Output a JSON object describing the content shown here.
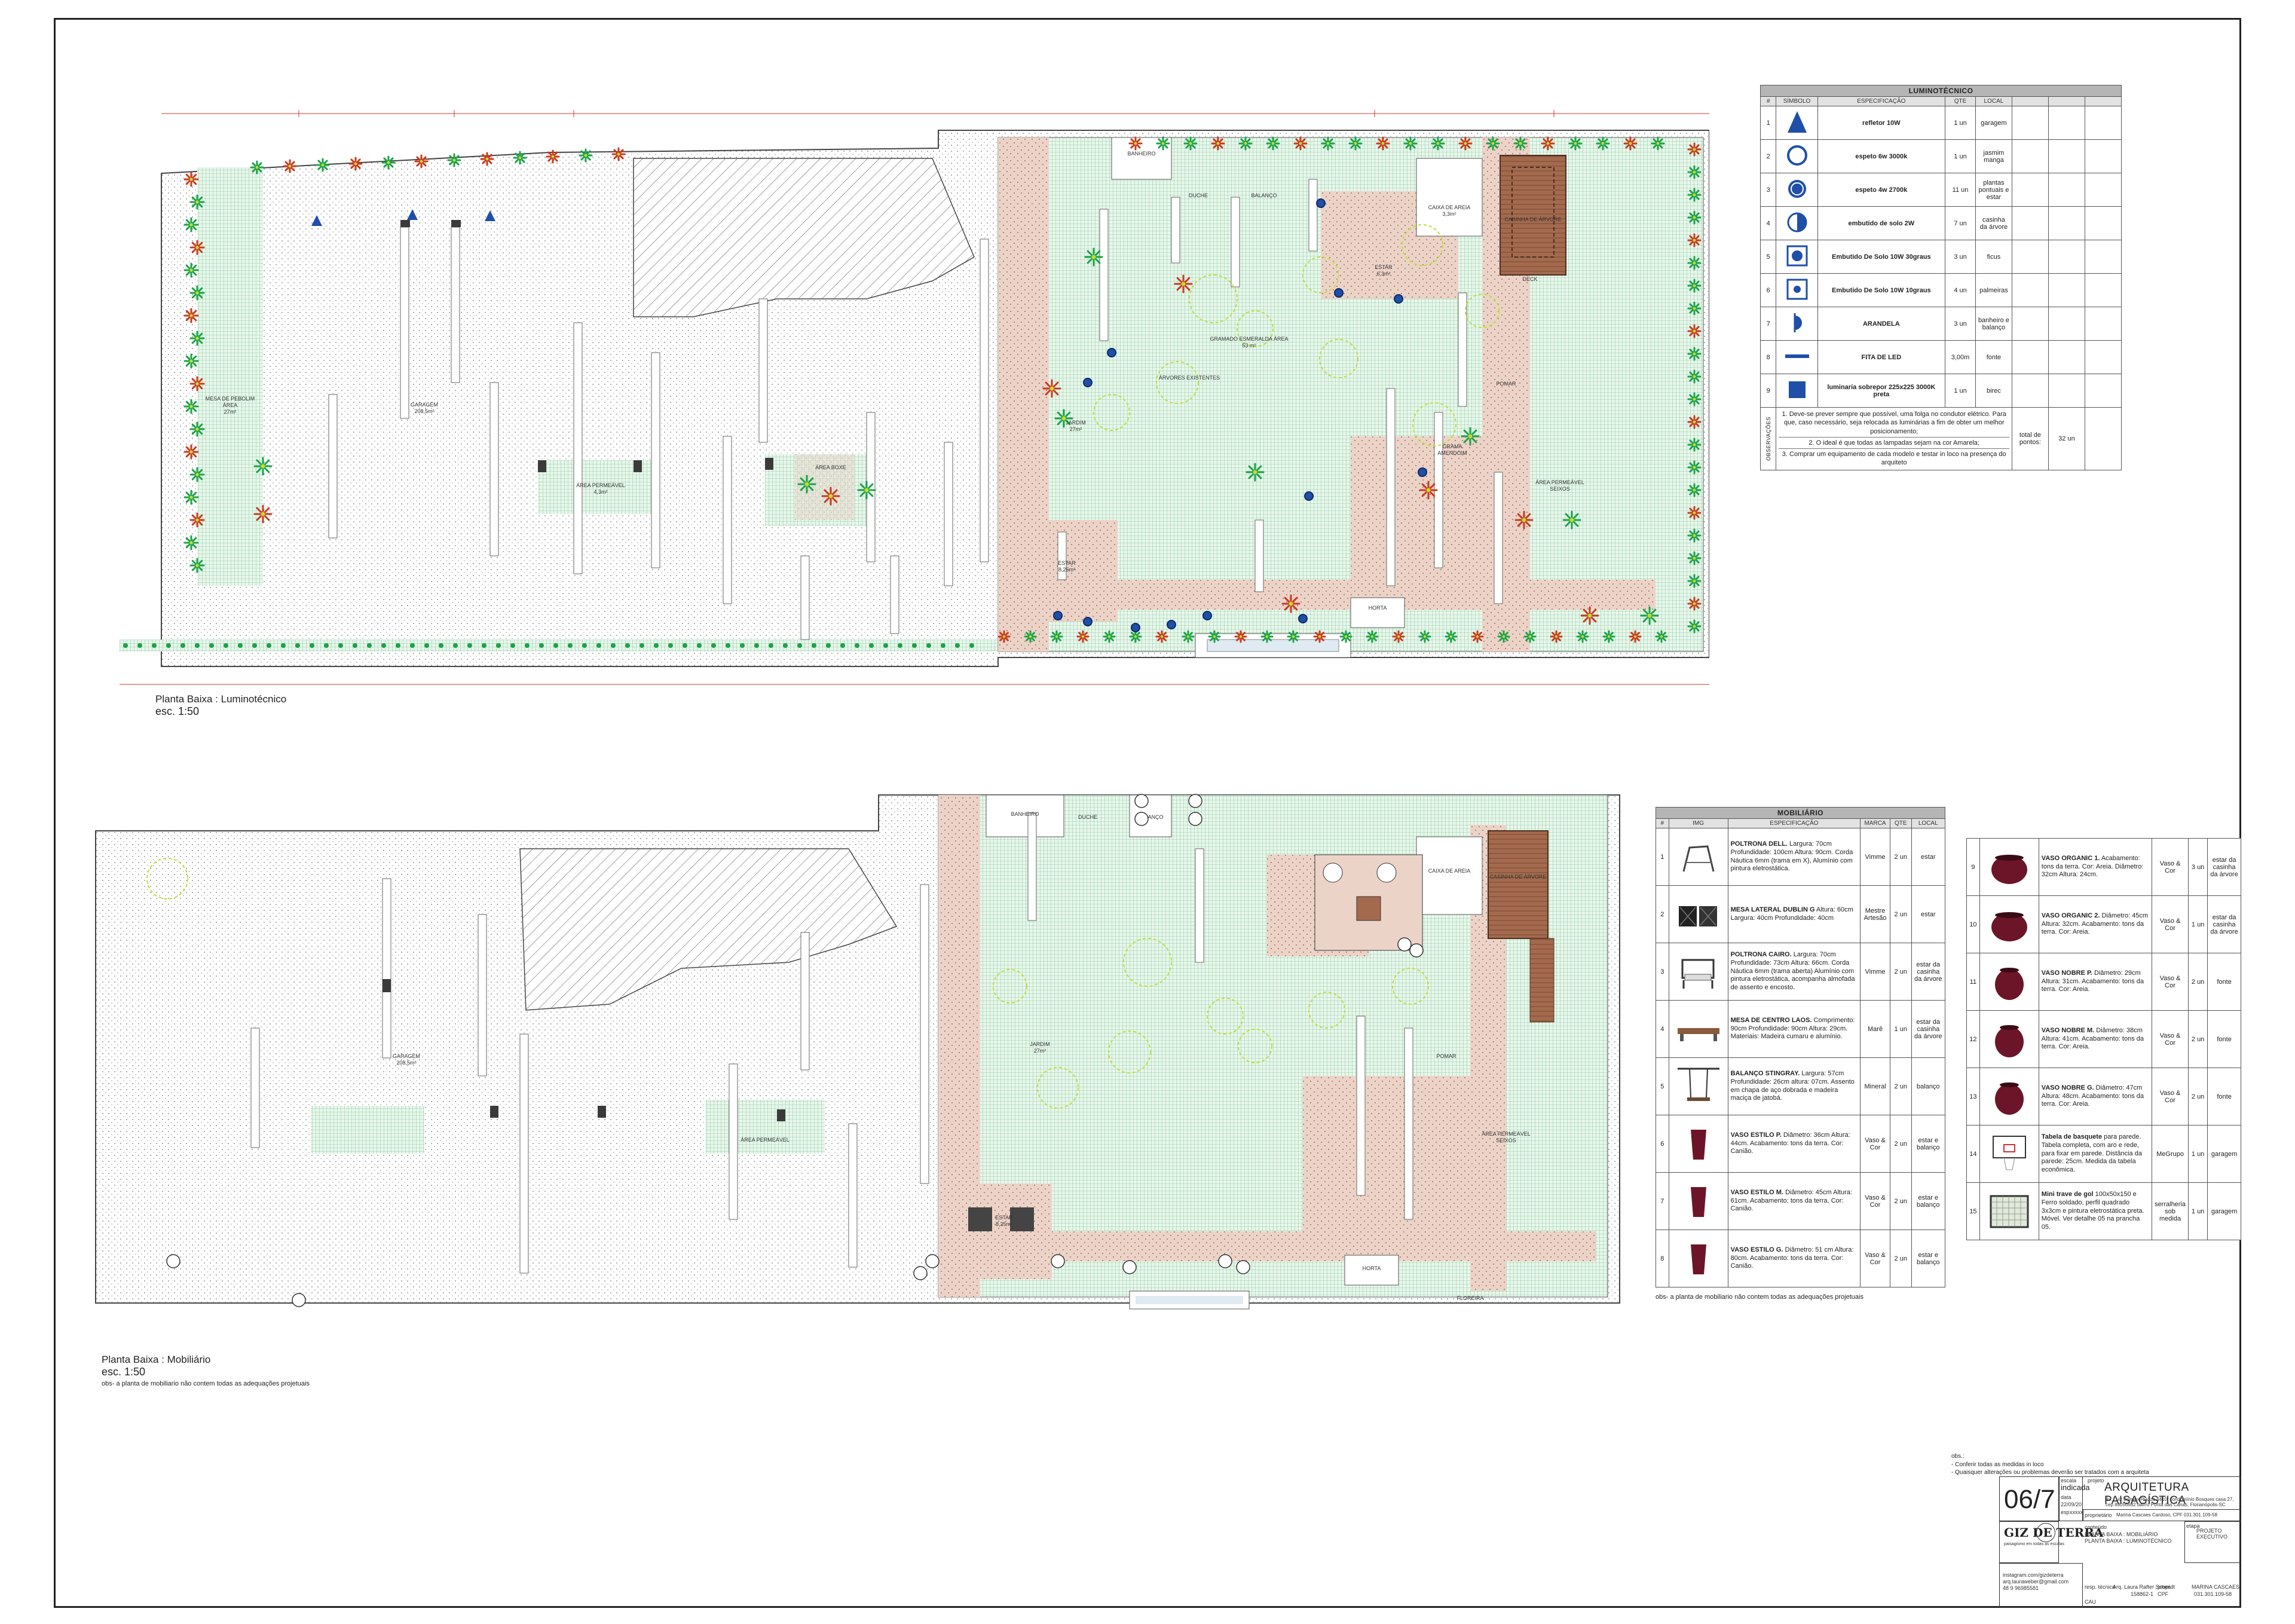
{
  "plan_top": {
    "caption_title": "Planta Baixa : Luminotécnico",
    "caption_scale": "esc. 1:50",
    "labels": {
      "garagem": "GARAGEM\n208,5m²",
      "mesa_futebol": "MESA DE PEBOLIM\nÁREA\n27m²",
      "area_permeavel": "ÁREA PERMEÁVEL\n4,3m²",
      "area_boxe": "ÁREA BOXE",
      "gramado": "GRAMADO ESMERALDA ÁREA\n53 m²",
      "arvores": "ÁRVORES EXISTENTES",
      "jardim": "JARDIM\n27m²",
      "estar": "ESTAR\n8,25m²",
      "estar_arvore": "ESTAR\n6,3m²",
      "caixa_areia": "CAIXA DE AREIA\n3,3m²",
      "casinha": "CASINHA DE ÁRVORE",
      "banheiro": "BANHEIRO",
      "horta": "HORTA",
      "pomar": "POMAR",
      "grama": "GRAMA\nAMENDOIM",
      "area_permeavel2": "ÁREA PERMEÁVEL\nSEIXOS",
      "duche": "DUCHE",
      "balanco": "BALANÇO",
      "deck": "DECK"
    }
  },
  "plan_bottom": {
    "caption_title": "Planta Baixa : Mobiliário",
    "caption_scale": "esc. 1:50",
    "caption_note": "obs- a planta de mobiliario não contem todas as adequações projetuais",
    "labels": {
      "garagem": "GARAGEM\n208,5m²",
      "banheiro": "BANHEIRO",
      "balanco": "BALANÇO",
      "duche": "DUCHE",
      "jardim": "JARDIM\n27m²",
      "estar": "ESTAR\n8,25m²",
      "caixa_areia": "CAIXA DE AREIA",
      "casinha": "CASINHA DE ÁRVORE",
      "pomar": "POMAR",
      "area_permeavel": "ÁREA PERMEÁVEL\nSEIXOS",
      "area_permeavel2": "ÁREA PERMEÁVEL",
      "horta": "HORTA",
      "floreira": "FLOREIRA"
    }
  },
  "luminotecnico": {
    "title": "LUMINOTÉCNICO",
    "headers": [
      "#",
      "SÍMBOLO",
      "ESPECIFICAÇÃO",
      "QTE",
      "LOCAL"
    ],
    "rows": [
      {
        "n": "1",
        "spec": "refletor 10W",
        "qte": "1 un",
        "local": "garagem",
        "icon": "triangle-icon"
      },
      {
        "n": "2",
        "spec": "espeto 6w 3000k",
        "qte": "1 un",
        "local": "jasmim manga",
        "icon": "ring-icon"
      },
      {
        "n": "3",
        "spec": "espeto 4w 2700k",
        "qte": "11 un",
        "local": "plantas pontuais e estar",
        "icon": "dot-ring-icon"
      },
      {
        "n": "4",
        "spec": "embutido de solo 2W",
        "qte": "7 un",
        "local": "casinha da árvore",
        "icon": "half-circle-icon"
      },
      {
        "n": "5",
        "spec": "Embutido De Solo 10W 30graus",
        "qte": "3 un",
        "local": "ficus",
        "icon": "square-circle-icon"
      },
      {
        "n": "6",
        "spec": "Embutido De Solo 10W 10graus",
        "qte": "4 un",
        "local": "palmeiras",
        "icon": "square-dot-icon"
      },
      {
        "n": "7",
        "spec": "ARANDELA",
        "qte": "3 un",
        "local": "banheiro e balanço",
        "icon": "arandela-icon"
      },
      {
        "n": "8",
        "spec": "FITA DE LED",
        "qte": "3,00m",
        "local": "fonte",
        "icon": "led-strip-icon"
      },
      {
        "n": "9",
        "spec": "luminaria sobrepor 225x225 3000K preta",
        "qte": "1 un",
        "local": "birec",
        "icon": "filled-square-icon"
      }
    ],
    "obs_label": "OBSERVAÇÕES",
    "obs": [
      "1. Deve-se prever sempre que possível, uma folga no condutor elétrico. Para que, caso necessário, seja relocada as luminárias a fim de obter um melhor posicionamento;",
      "2. O ideal é que todas as lampadas sejam na cor Amarela;",
      "3. Comprar um equipamento de cada modelo e testar in loco na presença do arquiteto"
    ],
    "total_label": "total de pontos:",
    "total_value": "32 un"
  },
  "mobiliario": {
    "title": "MOBILIÁRIO",
    "headers": [
      "#",
      "IMG",
      "ESPECIFICAÇÃO",
      "MARCA",
      "QTE",
      "LOCAL"
    ],
    "left_rows": [
      {
        "n": "1",
        "name": "POLTRONA DELL.",
        "desc": "Largura: 70cm Profundidade: 100cm Altura: 90cm. Corda Náutica 6mm (trama em X), Alumínio com pintura eletrostática.",
        "marca": "Vimme",
        "qte": "2 un",
        "local": "estar",
        "img": "chair-icon"
      },
      {
        "n": "2",
        "name": "MESA LATERAL DUBLIN G",
        "desc": "Altura: 60cm Largura: 40cm Profundidade: 40cm",
        "marca": "Mestre Artesão",
        "qte": "2 un",
        "local": "estar",
        "img": "side-table-icon"
      },
      {
        "n": "3",
        "name": "POLTRONA CAIRO.",
        "desc": "Largura: 70cm Profundidade: 73cm Altura: 66cm. Corda Náutica 6mm (trama aberta) Alumínio com pintura eletrostática, acompanha almofada de assento e encosto.",
        "marca": "Vimme",
        "qte": "2 un",
        "local": "estar da casinha da árvore",
        "img": "armchair-icon"
      },
      {
        "n": "4",
        "name": "MESA DE CENTRO LAOS.",
        "desc": "Comprimento: 90cm Profundidade: 90cm Altura: 29cm. Materiais: Madeira cumaru e alumínio.",
        "marca": "Marê",
        "qte": "1 un",
        "local": "estar da casinha da árvore",
        "img": "coffee-table-icon"
      },
      {
        "n": "5",
        "name": "BALANÇO STINGRAY.",
        "desc": "Largura: 57cm Profundidade: 26cm altura: 07cm. Assento em chapa de aço dobrada e madeira maciça de jatobá.",
        "marca": "Mineral",
        "qte": "2 un",
        "local": "balanço",
        "img": "swing-icon"
      },
      {
        "n": "6",
        "name": "VASO ESTILO P.",
        "desc": "Diâmetro: 36cm Altura: 44cm. Acabamento: tons da terra. Cor: Canião.",
        "marca": "Vaso & Cor",
        "qte": "2 un",
        "local": "estar e balanço",
        "img": "vase-icon"
      },
      {
        "n": "7",
        "name": "VASO ESTILO M.",
        "desc": "Diâmetro: 45cm Altura: 61cm. Acabamento: tons da terra. Cor: Canião.",
        "marca": "Vaso & Cor",
        "qte": "2 un",
        "local": "estar e balanço",
        "img": "vase-icon"
      },
      {
        "n": "8",
        "name": "VASO ESTILO G.",
        "desc": "Diâmetro: 51 cm Altura: 80cm. Acabamento: tons da terra. Cor: Canião.",
        "marca": "Vaso & Cor",
        "qte": "2 un",
        "local": "estar e balanço",
        "img": "vase-icon"
      }
    ],
    "right_rows": [
      {
        "n": "9",
        "name": "VASO ORGANIC 1.",
        "desc": "Acabamento: tons da terra. Cor: Areia. Diâmetro: 32cm Altura: 24cm.",
        "marca": "Vaso & Cor",
        "qte": "3 un",
        "local": "estar da casinha da árvore",
        "img": "bowl-vase-icon"
      },
      {
        "n": "10",
        "name": "VASO ORGANIC 2.",
        "desc": "Diâmetro: 45cm Altura: 32cm. Acabamento: tons da terra. Cor: Areia.",
        "marca": "Vaso & Cor",
        "qte": "1 un",
        "local": "estar da casinha da árvore",
        "img": "bowl-vase-icon"
      },
      {
        "n": "11",
        "name": "VASO NOBRE P.",
        "desc": "Diâmetro: 29cm Altura: 31cm. Acabamento: tons da terra. Cor: Areia.",
        "marca": "Vaso & Cor",
        "qte": "2 un",
        "local": "fonte",
        "img": "round-vase-icon"
      },
      {
        "n": "12",
        "name": "VASO NOBRE M.",
        "desc": "Diâmetro: 38cm Altura: 41cm. Acabamento: tons da terra. Cor: Areia.",
        "marca": "Vaso & Cor",
        "qte": "2 un",
        "local": "fonte",
        "img": "round-vase-icon"
      },
      {
        "n": "13",
        "name": "VASO NOBRE G.",
        "desc": "Diâmetro: 47cm Altura: 48cm. Acabamento: tons da terra. Cor: Areia.",
        "marca": "Vaso & Cor",
        "qte": "2 un",
        "local": "fonte",
        "img": "round-vase-icon"
      },
      {
        "n": "14",
        "name": "Tabela de basquete",
        "desc": "para parede. Tabela completa, com aro e rede, para fixar em parede. Distância da parede: 25cm. Medida da tabela econômica.",
        "marca": "MeGrupo",
        "qte": "1 un",
        "local": "garagem",
        "img": "basketball-icon"
      },
      {
        "n": "15",
        "name": "Mini trave de gol",
        "desc": "100x50x150 e Ferro soldado, perfil quadrado 3x3cm e pintura eletrostática preta. Móvel. Ver detalhe 05 na prancha 05.",
        "marca": "serralheria sob medida",
        "qte": "1 un",
        "local": "garagem",
        "img": "goal-icon"
      }
    ],
    "footnote": "obs- a planta de mobiliario não contem todas as adequações projetuais"
  },
  "notes": {
    "lines": [
      "obs.:",
      "-   Conferir todas as medidas in loco",
      "-   Quaisquer alterações ou problemas deverão ser tratados com a arquiteta"
    ]
  },
  "title_block": {
    "sheet_number": "06/7",
    "escala_label": "escala",
    "escala_value": "indicada",
    "data_label": "data",
    "data_value": "22/09/20",
    "esp_label": "esp.",
    "esp_value": "xxxxx",
    "project_label": "projeto",
    "project_title": "ARQUITETURA PAISAGÍSTICA",
    "address": "Av. Luiz Boiteux Piazza 4410, condomínio Bosques casa 27, cep 88056682 bairro Ponta das Canas, Florianópolis-SC",
    "owner_label": "proprietário",
    "owner": "Marina Cascaes Cardoso, CPF 031.301.109-58",
    "content_label": "conteúdo",
    "content_lines": [
      "PLANTA BAIXA : MOBILIÁRIO",
      "PLANTA BAIXA : LUMINOTÉCNICO"
    ],
    "stage_label": "etapa",
    "stage": "PROJETO EXECUTIVO",
    "brand": "GIZ DE TERRA",
    "brand_sub": "paisagismo em todas as escalas",
    "contact": [
      "instagram.com/gizdeterra",
      "arq.lauraweber@gmail.com",
      "48 9 96985581"
    ],
    "resp_label": "resp. técnica",
    "resp_name": "Arq. Laura Rafter Schmidt",
    "resp_id": "158862-1",
    "cau_label": "CAU",
    "cpf_label": "CPF",
    "prop_label": "propr.",
    "prop_name": "MARINA CASCAES",
    "prop_cpf": "031.301.109-58"
  },
  "colors": {
    "hatch_grass": "#1aa34a",
    "wood": "#a36a4e",
    "paver": "#d8b2a3",
    "lamp": "#1f4fa8",
    "plant_yellow": "#c8d92a",
    "plant_red": "#c93a1f",
    "vase": "#6d1528"
  }
}
